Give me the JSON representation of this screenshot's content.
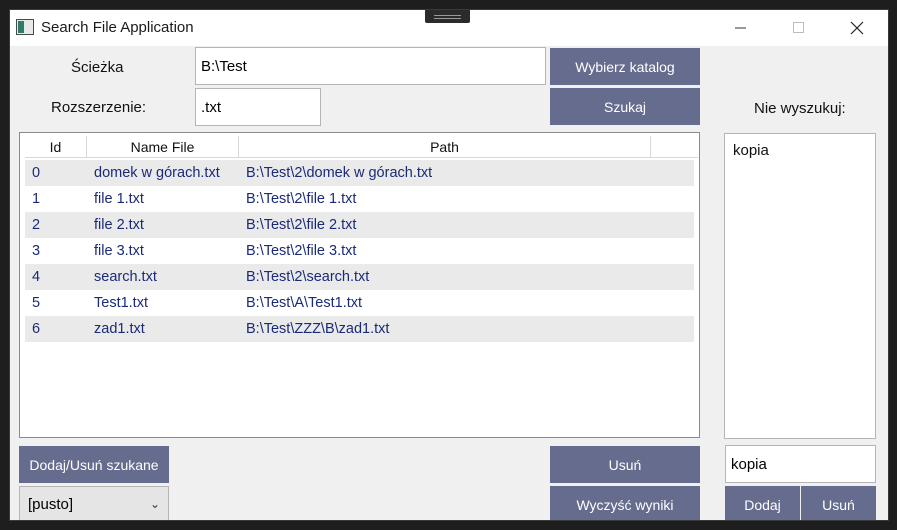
{
  "window": {
    "title": "Search File Application"
  },
  "form": {
    "path_label": "Ścieżka",
    "path_value": "B:\\Test",
    "ext_label": "Rozszerzenie:",
    "ext_value": ".txt",
    "choose_dir_button": "Wybierz katalog",
    "search_button": "Szukaj",
    "exclude_label": "Nie wyszukuj:"
  },
  "results": {
    "columns": [
      "Id",
      "Name File",
      "Path"
    ],
    "rows": [
      {
        "id": "0",
        "name": "domek w górach.txt",
        "path": "B:\\Test\\2\\domek w górach.txt"
      },
      {
        "id": "1",
        "name": "file 1.txt",
        "path": "B:\\Test\\2\\file 1.txt"
      },
      {
        "id": "2",
        "name": "file 2.txt",
        "path": "B:\\Test\\2\\file 2.txt"
      },
      {
        "id": "3",
        "name": "file 3.txt",
        "path": "B:\\Test\\2\\file 3.txt"
      },
      {
        "id": "4",
        "name": "search.txt",
        "path": "B:\\Test\\2\\search.txt"
      },
      {
        "id": "5",
        "name": "Test1.txt",
        "path": "B:\\Test\\A\\Test1.txt"
      },
      {
        "id": "6",
        "name": "zad1.txt",
        "path": "B:\\Test\\ZZZ\\B\\zad1.txt"
      }
    ]
  },
  "exclude": {
    "items": [
      "kopia"
    ],
    "input_value": "kopia",
    "add_button": "Dodaj",
    "remove_button": "Usuń"
  },
  "bottom": {
    "toggle_button": "Dodaj/Usuń szukane",
    "select_value": "[pusto]",
    "remove_button": "Usuń",
    "clear_button": "Wyczyść wyniki"
  },
  "colors": {
    "button_bg": "#666c8e",
    "result_text": "#1b2a78"
  }
}
